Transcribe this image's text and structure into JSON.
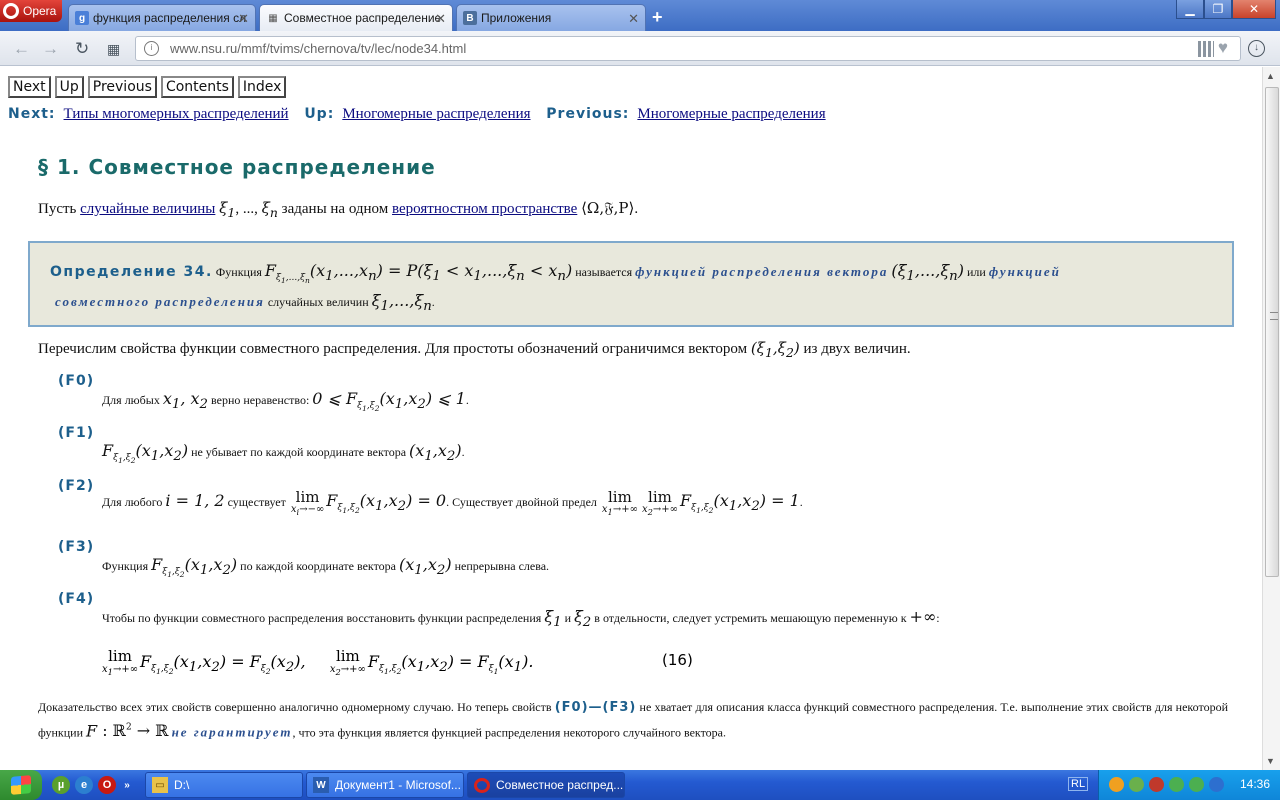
{
  "browser": {
    "menu_label": "Opera",
    "tabs": [
      {
        "label": "функция распределения сл",
        "icon": "google-icon"
      },
      {
        "label": "Совместное распределение",
        "icon": "page-icon",
        "active": true
      },
      {
        "label": "Приложения",
        "icon": "vk-icon"
      }
    ],
    "url_host": "www.nsu.ru",
    "url_path": "/mmf/tvims/chernova/tv/lec/node34.html"
  },
  "page": {
    "nav_buttons": [
      "Next",
      "Up",
      "Previous",
      "Contents",
      "Index"
    ],
    "crumbs": {
      "next_label": "Next:",
      "next_link": "Типы многомерных распределений",
      "up_label": "Up:",
      "up_link": "Многомерные распределения",
      "prev_label": "Previous:",
      "prev_link": "Многомерные распределения"
    },
    "title": "§ 1. Совместное распределение",
    "intro": {
      "t1": "Пусть",
      "link1": "случайные величины",
      "t2": ", ...,",
      "t3": "заданы на одном",
      "link2": "вероятностном пространстве"
    },
    "definition": {
      "title": "Определение 34.",
      "t1": "Функция",
      "t2": "называется",
      "em1": "функцией распределения вектора",
      "t3": "или",
      "em2a": "функцией",
      "em2b": "совместного распределения",
      "t4": "случайных величин"
    },
    "properties_intro": "Перечислим свойства функции совместного распределения. Для простоты обозначений ограничимся вектором",
    "properties_intro_end": "из двух величин.",
    "props": {
      "f0": {
        "label": "(F0)",
        "t1": "Для любых",
        "t2": "верно неравенство:"
      },
      "f1": {
        "label": "(F1)",
        "t1": "не убывает по каждой координате вектора"
      },
      "f2": {
        "label": "(F2)",
        "t1": "Для любого",
        "t2": "существует",
        "t3": ". Существует двойной предел"
      },
      "f3": {
        "label": "(F3)",
        "t1": "Функция",
        "t2": "по каждой координате вектора",
        "t3": "непрерывна слева."
      },
      "f4": {
        "label": "(F4)",
        "t1": "Чтобы по функции совместного распределения восстановить функции распределения",
        "t2": "и",
        "t3": "в отдельности, следует устремить мешающую переменную к"
      }
    },
    "eq_number": "(16)",
    "conclusion": {
      "t1": "Доказательство всех этих свойств совершенно аналогично одномерному случаю. Но теперь свойств",
      "ref": "(F0)—(F3)",
      "t2": "не хватает для описания класса функций совместного распределения. Т.е. выполнение этих свойств для некоторой функции",
      "em": "не гарантирует",
      "t3": ", что эта функция является функцией распределения некоторого случайного вектора."
    }
  },
  "taskbar": {
    "tasks": [
      {
        "label": "D:\\",
        "icon": "folder-icon"
      },
      {
        "label": "Документ1 - Microsof...",
        "icon": "word-icon"
      },
      {
        "label": "Совместное распред...",
        "icon": "opera-icon",
        "active": true
      }
    ],
    "lang": "RL",
    "clock": "14:36"
  }
}
